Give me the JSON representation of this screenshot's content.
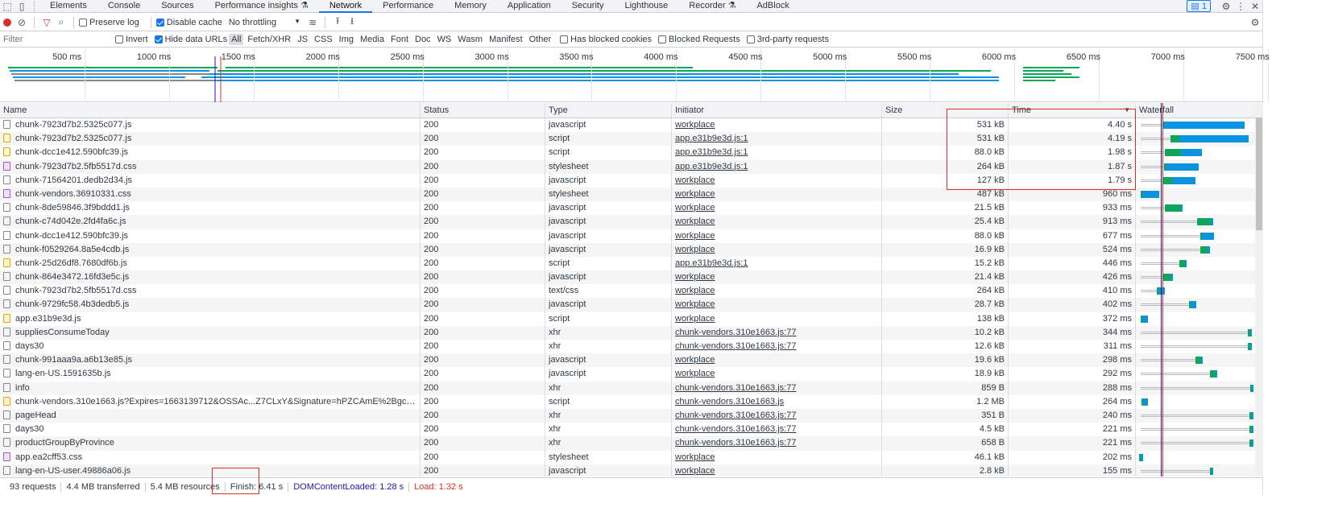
{
  "tabs": [
    "Elements",
    "Console",
    "Sources",
    "Performance insights ⚗",
    "Network",
    "Performance",
    "Memory",
    "Application",
    "Security",
    "Lighthouse",
    "Recorder ⚗",
    "AdBlock"
  ],
  "active_tab": "Network",
  "issues_badge": "1",
  "toolbar": {
    "preserve_log": "Preserve log",
    "preserve_log_checked": false,
    "disable_cache": "Disable cache",
    "disable_cache_checked": true,
    "throttling": "No throttling"
  },
  "filterbar": {
    "placeholder": "Filter",
    "invert": "Invert",
    "hide_data_urls": "Hide data URLs",
    "types": [
      "All",
      "Fetch/XHR",
      "JS",
      "CSS",
      "Img",
      "Media",
      "Font",
      "Doc",
      "WS",
      "Wasm",
      "Manifest",
      "Other"
    ],
    "active_type": "All",
    "blocked_cookies": "Has blocked cookies",
    "blocked_requests": "Blocked Requests",
    "third_party": "3rd-party requests"
  },
  "overview_ticks": [
    "500 ms",
    "1000 ms",
    "1500 ms",
    "2000 ms",
    "2500 ms",
    "3000 ms",
    "3500 ms",
    "4000 ms",
    "4500 ms",
    "5000 ms",
    "5500 ms",
    "6000 ms",
    "6500 ms",
    "7000 ms",
    "7500 ms"
  ],
  "columns": [
    "Name",
    "Status",
    "Type",
    "Initiator",
    "Size",
    "Time",
    "Waterfall"
  ],
  "sort_indicator": "▼",
  "rows": [
    {
      "name": "chunk-7923d7b2.5325c077.js",
      "icon": "file",
      "status": "200",
      "type": "javascript",
      "initiator": "workplace",
      "size": "531 kB",
      "time": "4.40 s",
      "wf": [
        1430,
        90,
        4330
      ]
    },
    {
      "name": "chunk-7923d7b2.5325c077.js",
      "icon": "script",
      "status": "200",
      "type": "script",
      "initiator": "app.e31b9e3d.js:1",
      "size": "531 kB",
      "time": "4.19 s",
      "wf": [
        1860,
        480,
        3720
      ]
    },
    {
      "name": "chunk-dcc1e412.590bfc39.js",
      "icon": "script",
      "status": "200",
      "type": "script",
      "initiator": "app.e31b9e3d.js:1",
      "size": "88.0 kB",
      "time": "1.98 s",
      "wf": [
        1560,
        870,
        1130
      ]
    },
    {
      "name": "chunk-7923d7b2.5fb5517d.css",
      "icon": "css",
      "status": "200",
      "type": "stylesheet",
      "initiator": "app.e31b9e3d.js:1",
      "size": "264 kB",
      "time": "1.87 s",
      "wf": [
        1520,
        80,
        1780
      ]
    },
    {
      "name": "chunk-71564201.dedb2d34.js",
      "icon": "file",
      "status": "200",
      "type": "javascript",
      "initiator": "workplace",
      "size": "127 kB",
      "time": "1.79 s",
      "wf": [
        1430,
        520,
        1250
      ]
    },
    {
      "name": "chunk-vendors.36910331.css",
      "icon": "css",
      "status": "200",
      "type": "stylesheet",
      "initiator": "workplace",
      "size": "487 kB",
      "time": "960 ms",
      "wf": [
        260,
        40,
        910
      ]
    },
    {
      "name": "chunk-8de59846.3f9bddd1.js",
      "icon": "file",
      "status": "200",
      "type": "javascript",
      "initiator": "workplace",
      "size": "21.5 kB",
      "time": "933 ms",
      "wf": [
        1560,
        870,
        40
      ]
    },
    {
      "name": "chunk-c74d042e.2fd4fa6c.js",
      "icon": "file",
      "status": "200",
      "type": "javascript",
      "initiator": "workplace",
      "size": "25.4 kB",
      "time": "913 ms",
      "wf": [
        3290,
        740,
        130
      ]
    },
    {
      "name": "chunk-dcc1e412.590bfc39.js",
      "icon": "file",
      "status": "200",
      "type": "javascript",
      "initiator": "workplace",
      "size": "88.0 kB",
      "time": "677 ms",
      "wf": [
        3460,
        90,
        650
      ]
    },
    {
      "name": "chunk-f0529264.8a5e4cdb.js",
      "icon": "file",
      "status": "200",
      "type": "javascript",
      "initiator": "workplace",
      "size": "16.9 kB",
      "time": "524 ms",
      "wf": [
        3470,
        390,
        130
      ]
    },
    {
      "name": "chunk-25d26df8.7680df6b.js",
      "icon": "script",
      "status": "200",
      "type": "script",
      "initiator": "app.e31b9e3d.js:1",
      "size": "15.2 kB",
      "time": "446 ms",
      "wf": [
        2340,
        300,
        60
      ]
    },
    {
      "name": "chunk-864e3472.16fd3e5c.js",
      "icon": "file",
      "status": "200",
      "type": "javascript",
      "initiator": "workplace",
      "size": "21.4 kB",
      "time": "426 ms",
      "wf": [
        1470,
        420,
        40
      ]
    },
    {
      "name": "chunk-7923d7b2.5fb5517d.css",
      "icon": "file",
      "status": "200",
      "type": "text/css",
      "initiator": "workplace",
      "size": "264 kB",
      "time": "410 ms",
      "wf": [
        1130,
        40,
        350
      ]
    },
    {
      "name": "chunk-9729fc58.4b3dedb5.js",
      "icon": "file",
      "status": "200",
      "type": "javascript",
      "initiator": "workplace",
      "size": "28.7 kB",
      "time": "402 ms",
      "wf": [
        2860,
        90,
        300
      ]
    },
    {
      "name": "app.e31b9e3d.js",
      "icon": "script",
      "status": "200",
      "type": "script",
      "initiator": "workplace",
      "size": "138 kB",
      "time": "372 ms",
      "wf": [
        280,
        40,
        300
      ]
    },
    {
      "name": "suppliesConsumeToday",
      "icon": "file",
      "status": "200",
      "type": "xhr",
      "initiator": "chunk-vendors.310e1663.js:77",
      "size": "10.2 kB",
      "time": "344 ms",
      "wf": [
        6010,
        130,
        40
      ]
    },
    {
      "name": "days30",
      "icon": "file",
      "status": "200",
      "type": "xhr",
      "initiator": "chunk-vendors.310e1663.js:77",
      "size": "12.6 kB",
      "time": "311 ms",
      "wf": [
        6010,
        130,
        40
      ]
    },
    {
      "name": "chunk-991aaa9a.a6b13e85.js",
      "icon": "file",
      "status": "200",
      "type": "javascript",
      "initiator": "workplace",
      "size": "19.6 kB",
      "time": "298 ms",
      "wf": [
        3210,
        300,
        40
      ]
    },
    {
      "name": "lang-en-US.1591635b.js",
      "icon": "file",
      "status": "200",
      "type": "javascript",
      "initiator": "workplace",
      "size": "18.9 kB",
      "time": "292 ms",
      "wf": [
        3990,
        300,
        40
      ]
    },
    {
      "name": "info",
      "icon": "file",
      "status": "200",
      "type": "xhr",
      "initiator": "chunk-vendors.310e1663.js:77",
      "size": "859 B",
      "time": "288 ms",
      "wf": [
        6150,
        100,
        20
      ]
    },
    {
      "name": "chunk-vendors.310e1663.js?Expires=1663139712&OSSAc...Z7CLxY&Signature=hPZCAmE%2BgcqBSzEAwnq3pFG...",
      "icon": "script",
      "status": "200",
      "type": "script",
      "initiator": "chunk-vendors.310e1663.js",
      "size": "1.2 MB",
      "time": "264 ms",
      "wf": [
        300,
        40,
        260
      ]
    },
    {
      "name": "pageHead",
      "icon": "file",
      "status": "200",
      "type": "xhr",
      "initiator": "chunk-vendors.310e1663.js:77",
      "size": "351 B",
      "time": "240 ms",
      "wf": [
        6110,
        120,
        20
      ]
    },
    {
      "name": "days30",
      "icon": "file",
      "status": "200",
      "type": "xhr",
      "initiator": "chunk-vendors.310e1663.js:77",
      "size": "4.5 kB",
      "time": "221 ms",
      "wf": [
        6110,
        120,
        20
      ]
    },
    {
      "name": "productGroupByProvince",
      "icon": "file",
      "status": "200",
      "type": "xhr",
      "initiator": "chunk-vendors.310e1663.js:77",
      "size": "658 B",
      "time": "221 ms",
      "wf": [
        6110,
        120,
        20
      ]
    },
    {
      "name": "app.ea2cff53.css",
      "icon": "css",
      "status": "200",
      "type": "stylesheet",
      "initiator": "workplace",
      "size": "46.1 kB",
      "time": "202 ms",
      "wf": [
        170,
        40,
        130
      ]
    },
    {
      "name": "lang-en-US-user.49886a06.js",
      "icon": "file",
      "status": "200",
      "type": "javascript",
      "initiator": "workplace",
      "size": "2.8 kB",
      "time": "155 ms",
      "wf": [
        3990,
        100,
        40
      ]
    }
  ],
  "status": {
    "requests": "93 requests",
    "transferred": "4.4 MB transferred",
    "resources": "5.4 MB resources",
    "finish": "Finish: 6.41 s",
    "dcl": "DOMContentLoaded: 1.28 s",
    "load": "Load: 1.32 s"
  },
  "colors": {
    "accent": "#1a73e8",
    "waiting": "#0fa55a",
    "download": "#0a94e0",
    "dcl": "#1a1aa6",
    "load": "#d93025"
  }
}
